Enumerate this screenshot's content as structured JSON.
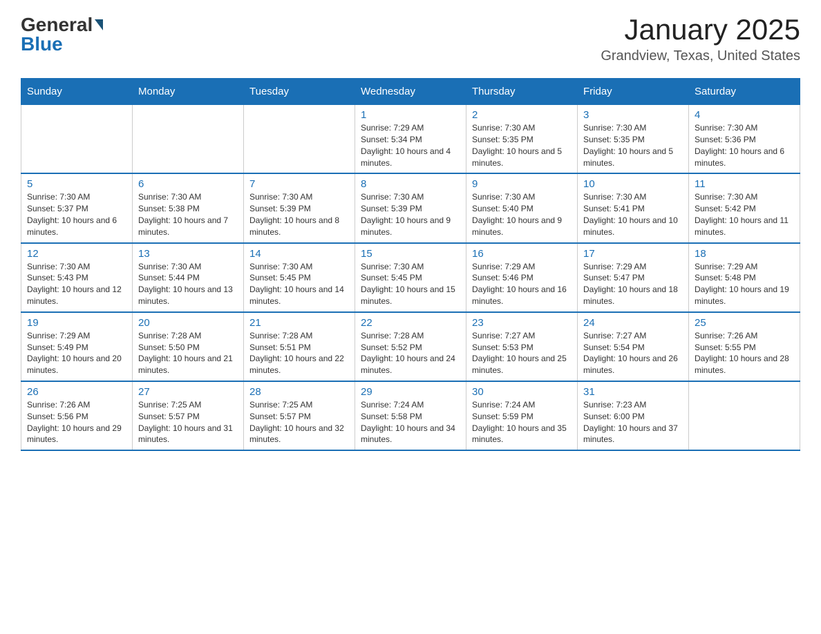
{
  "header": {
    "logo_general": "General",
    "logo_blue": "Blue",
    "month_title": "January 2025",
    "location": "Grandview, Texas, United States"
  },
  "days_of_week": [
    "Sunday",
    "Monday",
    "Tuesday",
    "Wednesday",
    "Thursday",
    "Friday",
    "Saturday"
  ],
  "weeks": [
    [
      {
        "day": "",
        "info": ""
      },
      {
        "day": "",
        "info": ""
      },
      {
        "day": "",
        "info": ""
      },
      {
        "day": "1",
        "info": "Sunrise: 7:29 AM\nSunset: 5:34 PM\nDaylight: 10 hours and 4 minutes."
      },
      {
        "day": "2",
        "info": "Sunrise: 7:30 AM\nSunset: 5:35 PM\nDaylight: 10 hours and 5 minutes."
      },
      {
        "day": "3",
        "info": "Sunrise: 7:30 AM\nSunset: 5:35 PM\nDaylight: 10 hours and 5 minutes."
      },
      {
        "day": "4",
        "info": "Sunrise: 7:30 AM\nSunset: 5:36 PM\nDaylight: 10 hours and 6 minutes."
      }
    ],
    [
      {
        "day": "5",
        "info": "Sunrise: 7:30 AM\nSunset: 5:37 PM\nDaylight: 10 hours and 6 minutes."
      },
      {
        "day": "6",
        "info": "Sunrise: 7:30 AM\nSunset: 5:38 PM\nDaylight: 10 hours and 7 minutes."
      },
      {
        "day": "7",
        "info": "Sunrise: 7:30 AM\nSunset: 5:39 PM\nDaylight: 10 hours and 8 minutes."
      },
      {
        "day": "8",
        "info": "Sunrise: 7:30 AM\nSunset: 5:39 PM\nDaylight: 10 hours and 9 minutes."
      },
      {
        "day": "9",
        "info": "Sunrise: 7:30 AM\nSunset: 5:40 PM\nDaylight: 10 hours and 9 minutes."
      },
      {
        "day": "10",
        "info": "Sunrise: 7:30 AM\nSunset: 5:41 PM\nDaylight: 10 hours and 10 minutes."
      },
      {
        "day": "11",
        "info": "Sunrise: 7:30 AM\nSunset: 5:42 PM\nDaylight: 10 hours and 11 minutes."
      }
    ],
    [
      {
        "day": "12",
        "info": "Sunrise: 7:30 AM\nSunset: 5:43 PM\nDaylight: 10 hours and 12 minutes."
      },
      {
        "day": "13",
        "info": "Sunrise: 7:30 AM\nSunset: 5:44 PM\nDaylight: 10 hours and 13 minutes."
      },
      {
        "day": "14",
        "info": "Sunrise: 7:30 AM\nSunset: 5:45 PM\nDaylight: 10 hours and 14 minutes."
      },
      {
        "day": "15",
        "info": "Sunrise: 7:30 AM\nSunset: 5:45 PM\nDaylight: 10 hours and 15 minutes."
      },
      {
        "day": "16",
        "info": "Sunrise: 7:29 AM\nSunset: 5:46 PM\nDaylight: 10 hours and 16 minutes."
      },
      {
        "day": "17",
        "info": "Sunrise: 7:29 AM\nSunset: 5:47 PM\nDaylight: 10 hours and 18 minutes."
      },
      {
        "day": "18",
        "info": "Sunrise: 7:29 AM\nSunset: 5:48 PM\nDaylight: 10 hours and 19 minutes."
      }
    ],
    [
      {
        "day": "19",
        "info": "Sunrise: 7:29 AM\nSunset: 5:49 PM\nDaylight: 10 hours and 20 minutes."
      },
      {
        "day": "20",
        "info": "Sunrise: 7:28 AM\nSunset: 5:50 PM\nDaylight: 10 hours and 21 minutes."
      },
      {
        "day": "21",
        "info": "Sunrise: 7:28 AM\nSunset: 5:51 PM\nDaylight: 10 hours and 22 minutes."
      },
      {
        "day": "22",
        "info": "Sunrise: 7:28 AM\nSunset: 5:52 PM\nDaylight: 10 hours and 24 minutes."
      },
      {
        "day": "23",
        "info": "Sunrise: 7:27 AM\nSunset: 5:53 PM\nDaylight: 10 hours and 25 minutes."
      },
      {
        "day": "24",
        "info": "Sunrise: 7:27 AM\nSunset: 5:54 PM\nDaylight: 10 hours and 26 minutes."
      },
      {
        "day": "25",
        "info": "Sunrise: 7:26 AM\nSunset: 5:55 PM\nDaylight: 10 hours and 28 minutes."
      }
    ],
    [
      {
        "day": "26",
        "info": "Sunrise: 7:26 AM\nSunset: 5:56 PM\nDaylight: 10 hours and 29 minutes."
      },
      {
        "day": "27",
        "info": "Sunrise: 7:25 AM\nSunset: 5:57 PM\nDaylight: 10 hours and 31 minutes."
      },
      {
        "day": "28",
        "info": "Sunrise: 7:25 AM\nSunset: 5:57 PM\nDaylight: 10 hours and 32 minutes."
      },
      {
        "day": "29",
        "info": "Sunrise: 7:24 AM\nSunset: 5:58 PM\nDaylight: 10 hours and 34 minutes."
      },
      {
        "day": "30",
        "info": "Sunrise: 7:24 AM\nSunset: 5:59 PM\nDaylight: 10 hours and 35 minutes."
      },
      {
        "day": "31",
        "info": "Sunrise: 7:23 AM\nSunset: 6:00 PM\nDaylight: 10 hours and 37 minutes."
      },
      {
        "day": "",
        "info": ""
      }
    ]
  ]
}
